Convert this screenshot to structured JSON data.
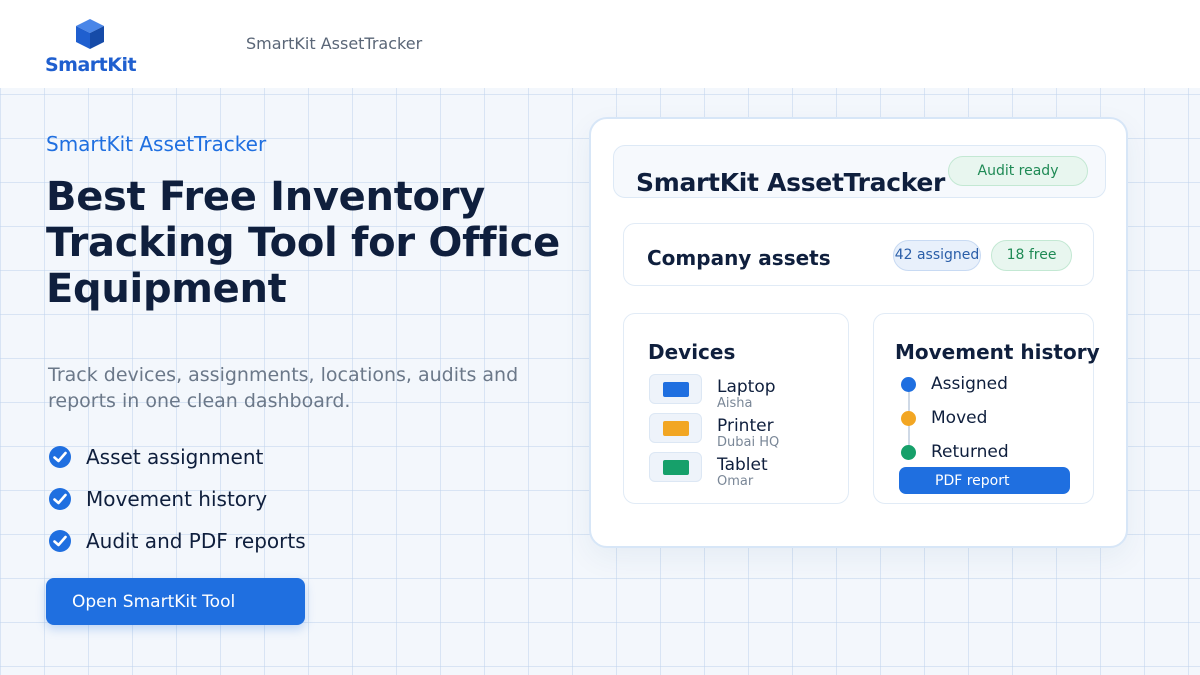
{
  "brand": {
    "logo_text": "SmartKit",
    "header_title": "SmartKit AssetTracker"
  },
  "hero": {
    "eyebrow": "SmartKit AssetTracker",
    "headline_lines": [
      "Best Free Inventory",
      "Tracking Tool for Office",
      "Equipment"
    ],
    "subtext_lines": [
      "Track devices, assignments, locations, audits and",
      "reports in one clean dashboard."
    ],
    "features": [
      {
        "label": "Asset assignment",
        "icon": "check-circle-icon"
      },
      {
        "label": "Movement history",
        "icon": "check-circle-icon"
      },
      {
        "label": "Audit and PDF reports",
        "icon": "check-circle-icon"
      }
    ],
    "cta_label": "Open SmartKit Tool"
  },
  "panel": {
    "title": "SmartKit AssetTracker",
    "status_pill": "Audit ready",
    "assets": {
      "title": "Company assets",
      "assigned": "42 assigned",
      "free": "18 free"
    },
    "devices": {
      "title": "Devices",
      "items": [
        {
          "name": "Laptop",
          "sub": "Aisha",
          "color": "#1f6fe0"
        },
        {
          "name": "Printer",
          "sub": "Dubai HQ",
          "color": "#f2a623"
        },
        {
          "name": "Tablet",
          "sub": "Omar",
          "color": "#16a06a"
        }
      ]
    },
    "history": {
      "title": "Movement history",
      "items": [
        {
          "label": "Assigned",
          "color": "#1f6fe0"
        },
        {
          "label": "Moved",
          "color": "#f2a623"
        },
        {
          "label": "Returned",
          "color": "#16a06a"
        }
      ],
      "report_button": "PDF report"
    }
  },
  "colors": {
    "accent": "#1f6fe0",
    "heading": "#0f1f3d",
    "success": "#16a06a",
    "warning": "#f2a623"
  }
}
